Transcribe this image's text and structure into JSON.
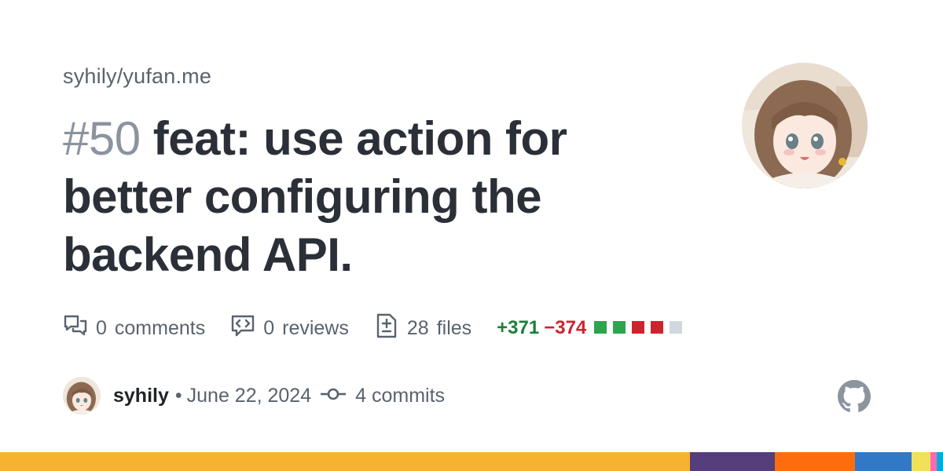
{
  "repo": "syhily/yufan.me",
  "pr": {
    "number": "#50",
    "title": "feat: use action for better configuring the backend API."
  },
  "stats": {
    "comments": {
      "count": "0",
      "label": "comments",
      "icon": "comment-discussion-icon"
    },
    "reviews": {
      "count": "0",
      "label": "reviews",
      "icon": "code-review-icon"
    },
    "files": {
      "count": "28",
      "label": "files",
      "icon": "file-diff-icon"
    },
    "additions": "+371",
    "deletions": "−374",
    "diff_blocks": [
      "#2da44e",
      "#2da44e",
      "#cf222e",
      "#cf222e",
      "#d0d7de"
    ]
  },
  "footer": {
    "author": "syhily",
    "separator": "•",
    "date": "June 22, 2024",
    "commits": "4 commits",
    "commit_icon": "git-commit-icon",
    "logo_icon": "github-logo-icon"
  },
  "language_bar_colors": [
    "#f7b22f",
    "#563d7c",
    "#fd6d0e",
    "#3178c6",
    "#f1e05a",
    "#ff69b4",
    "#00add8"
  ],
  "colors": {
    "text": "#1f2328",
    "muted": "#59636e",
    "addition": "#1a7f37",
    "deletion": "#cf222e"
  }
}
